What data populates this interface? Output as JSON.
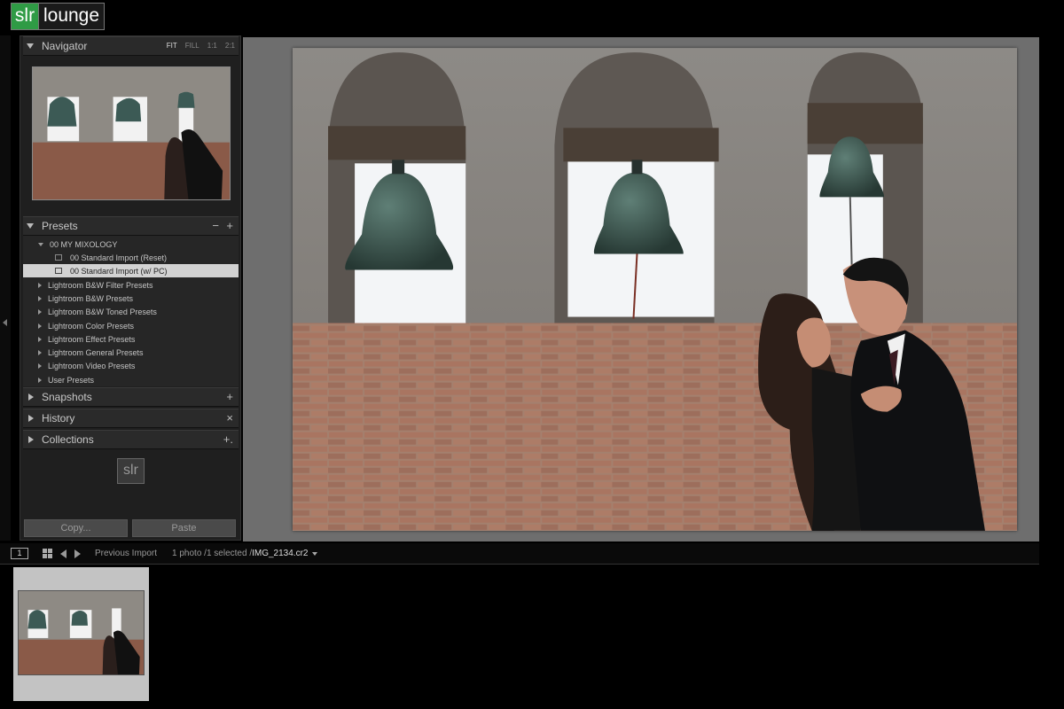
{
  "brand": {
    "part1": "slr",
    "part2": "lounge"
  },
  "navigator": {
    "title": "Navigator",
    "modes": [
      "FIT",
      "FILL",
      "1:1",
      "2:1"
    ]
  },
  "presets": {
    "title": "Presets",
    "minus": "−",
    "plus": "+",
    "items": [
      {
        "label": "00 MY MIXOLOGY",
        "kind": "folder-open"
      },
      {
        "label": "00 Standard Import (Reset)",
        "kind": "preset"
      },
      {
        "label": "00 Standard Import (w/ PC)",
        "kind": "preset",
        "selected": true
      },
      {
        "label": "Lightroom B&W Filter Presets",
        "kind": "folder"
      },
      {
        "label": "Lightroom B&W Presets",
        "kind": "folder"
      },
      {
        "label": "Lightroom B&W Toned Presets",
        "kind": "folder"
      },
      {
        "label": "Lightroom Color Presets",
        "kind": "folder"
      },
      {
        "label": "Lightroom Effect Presets",
        "kind": "folder"
      },
      {
        "label": "Lightroom General Presets",
        "kind": "folder"
      },
      {
        "label": "Lightroom Video Presets",
        "kind": "folder"
      },
      {
        "label": "User Presets",
        "kind": "folder"
      }
    ]
  },
  "snapshots": {
    "title": "Snapshots",
    "action": "+"
  },
  "history": {
    "title": "History",
    "action": "×"
  },
  "collections": {
    "title": "Collections",
    "action": "+."
  },
  "panel_logo": "slr",
  "buttons": {
    "copy": "Copy...",
    "paste": "Paste"
  },
  "filmstrip": {
    "screen": "1",
    "source": "Previous Import",
    "selection": "1 photo /1 selected /",
    "filename": "IMG_2134.cr2"
  },
  "colors": {
    "brand_green": "#2f9b45",
    "panel_bg": "#1f1f1f",
    "canvas_bg": "#6e6e6e"
  }
}
